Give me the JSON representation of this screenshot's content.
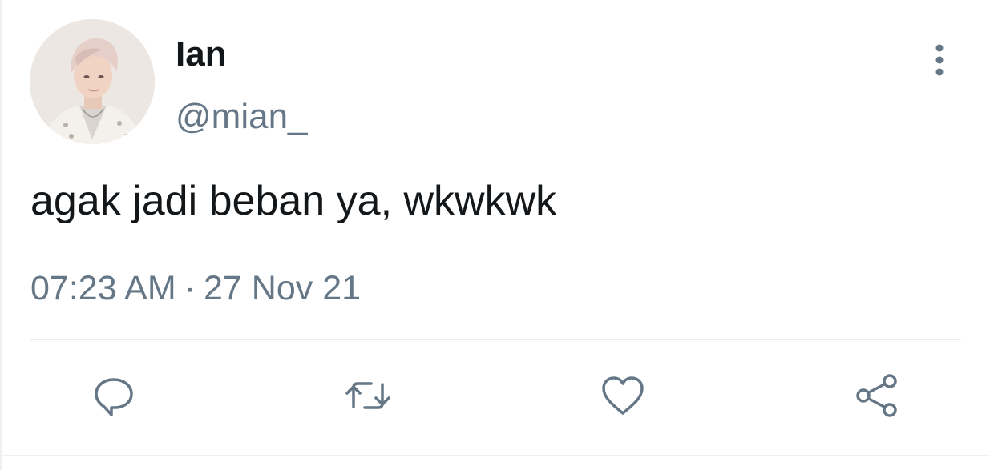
{
  "tweet": {
    "author": {
      "display_name": "Ian",
      "handle": "@mian_"
    },
    "text": "agak jadi beban ya, wkwkwk",
    "timestamp": {
      "time": "07:23 AM",
      "separator": "·",
      "date": "27 Nov 21"
    },
    "actions": [
      {
        "icon": "reply-icon"
      },
      {
        "icon": "retweet-icon"
      },
      {
        "icon": "like-icon"
      },
      {
        "icon": "share-icon"
      }
    ],
    "more_icon": "more-vertical-icon"
  },
  "colors": {
    "primary_text": "#14171a",
    "secondary_text": "#657786",
    "divider": "#e6ecf0",
    "background": "#ffffff"
  }
}
